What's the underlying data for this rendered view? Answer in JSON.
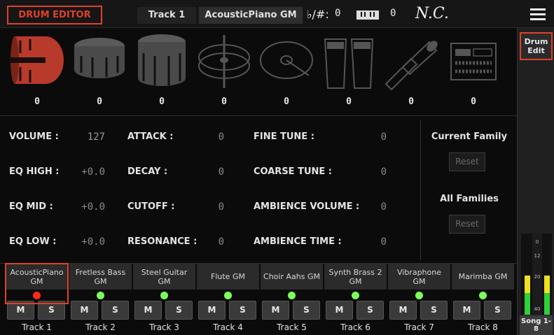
{
  "header": {
    "title": "DRUM EDITOR",
    "track": "Track 1",
    "sound": "AcousticPiano GM",
    "transpose_icon": "♭/#:",
    "transpose_value": "0",
    "octave_value": "0",
    "chord": "N.C.",
    "menu_icon": "hamburger-menu-icon"
  },
  "drums": [
    {
      "icon": "kick-drum-icon",
      "value": "0"
    },
    {
      "icon": "snare-drum-icon",
      "value": "0"
    },
    {
      "icon": "tom-drum-icon",
      "value": "0"
    },
    {
      "icon": "hihat-cymbal-icon",
      "value": "0"
    },
    {
      "icon": "ride-cymbal-icon",
      "value": "0"
    },
    {
      "icon": "conga-icon",
      "value": "0"
    },
    {
      "icon": "percussion-icon",
      "value": "0"
    },
    {
      "icon": "sfx-box-icon",
      "value": "0"
    }
  ],
  "params": {
    "volume": {
      "label": "VOLUME :",
      "value": "127"
    },
    "eq_high": {
      "label": "EQ HIGH :",
      "value": "+0.0"
    },
    "eq_mid": {
      "label": "EQ MID :",
      "value": "+0.0"
    },
    "eq_low": {
      "label": "EQ LOW :",
      "value": "+0.0"
    },
    "attack": {
      "label": "ATTACK :",
      "value": "0"
    },
    "decay": {
      "label": "DECAY :",
      "value": "0"
    },
    "cutoff": {
      "label": "CUTOFF :",
      "value": "0"
    },
    "resonance": {
      "label": "RESONANCE :",
      "value": "0"
    },
    "fine_tune": {
      "label": "FINE TUNE :",
      "value": "0"
    },
    "coarse_tune": {
      "label": "COARSE TUNE :",
      "value": "0"
    },
    "ambience_volume": {
      "label": "AMBIENCE VOLUME :",
      "value": "0"
    },
    "ambience_time": {
      "label": "AMBIENCE TIME :",
      "value": "0"
    }
  },
  "family": {
    "current_label": "Current Family",
    "all_label": "All Families",
    "reset_label": "Reset"
  },
  "tabs": {
    "drum_edit": "Drum Edit",
    "song": "Song 1-8"
  },
  "meter": {
    "scale": [
      "0",
      "12",
      "20",
      "40"
    ],
    "level_left": 0.48,
    "level_right": 0.48
  },
  "mixer": {
    "mute_label": "M",
    "solo_label": "S",
    "channels": [
      {
        "name": "AcousticPiano GM",
        "track": "Track 1",
        "led": "#ff2a1a"
      },
      {
        "name": "Fretless Bass GM",
        "track": "Track 2",
        "led": "#7cff5a"
      },
      {
        "name": "Steel Guitar GM",
        "track": "Track 3",
        "led": "#7cff5a"
      },
      {
        "name": "Flute GM",
        "track": "Track 4",
        "led": "#7cff5a"
      },
      {
        "name": "Choir Aahs GM",
        "track": "Track 5",
        "led": "#7cff5a"
      },
      {
        "name": "Synth Brass 2 GM",
        "track": "Track 6",
        "led": "#7cff5a"
      },
      {
        "name": "Vibraphone GM",
        "track": "Track 7",
        "led": "#7cff5a"
      },
      {
        "name": "Marimba GM",
        "track": "Track 8",
        "led": "#7cff5a"
      }
    ]
  },
  "colors": {
    "accent": "#e0402a",
    "selected_drum": "#b83a2a",
    "drum_gray": "#555555",
    "meter_green": "#2fd13a",
    "meter_yellow": "#f0e020"
  }
}
